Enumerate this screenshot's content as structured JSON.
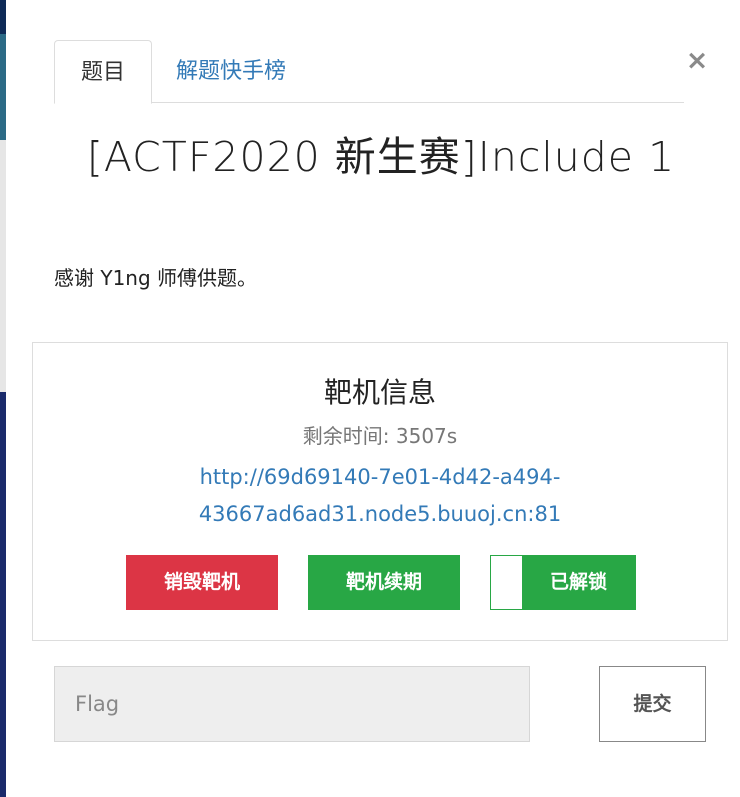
{
  "modal": {
    "close_glyph": "×",
    "tabs": [
      {
        "label": "题目",
        "active": true
      },
      {
        "label": "解题快手榜",
        "active": false
      }
    ],
    "challenge_title": "[ACTF2020 新生赛]Include 1",
    "description": "感谢 Y1ng 师傅供题。"
  },
  "target": {
    "heading": "靶机信息",
    "remaining": "剩余时间: 3507s",
    "url_line1": "http://69d69140-7e01-4d42-a494-",
    "url_line2": "43667ad6ad31.node5.buuoj.cn:81",
    "buttons": {
      "destroy": "销毁靶机",
      "renew": "靶机续期",
      "toggle": "已解锁"
    }
  },
  "flag_form": {
    "placeholder": "Flag",
    "value": "",
    "submit": "提交"
  },
  "colors": {
    "link": "#337ab7",
    "danger": "#dc3545",
    "success": "#28a745"
  }
}
